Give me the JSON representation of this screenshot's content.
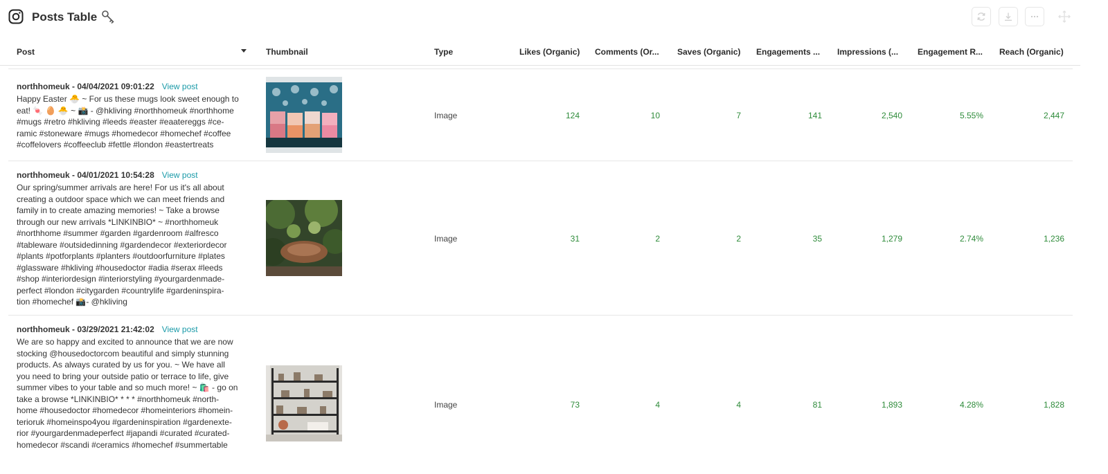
{
  "header": {
    "title": "Posts Table",
    "icons": [
      "instagram-icon",
      "key-icon",
      "refresh-icon",
      "download-icon",
      "more-icon",
      "move-icon"
    ]
  },
  "columns": [
    "Post",
    "Thumbnail",
    "Type",
    "Likes (Organic)",
    "Comments (Or...",
    "Saves (Organic)",
    "Engagements ...",
    "Impressions (...",
    "Engagement R...",
    "Reach (Organic)"
  ],
  "view_post_label": "View post",
  "rows": [
    {
      "account_date": "northhomeuk - 04/04/2021 09:01:22",
      "caption": "Happy Easter 🐣 ~ For us these mugs look sweet enough to\neat! 🍬 🥚 🐣 ~ 📸 - @hkliving #northhomeuk #northhome\n#mugs #retro #hkliving #leeds #easter #eaatereggs #ce-\nramic #stoneware #mugs #homedecor #homechef #coffee\n#coffelovers #coffeeclub #fettle #london #eastertreats",
      "type": "Image",
      "likes": "124",
      "comments": "10",
      "saves": "7",
      "engagements": "141",
      "impressions": "2,540",
      "engagement_rate": "5.55%",
      "reach": "2,447"
    },
    {
      "account_date": "northhomeuk - 04/01/2021 10:54:28",
      "caption": "Our spring/summer arrivals are here! For us it's all about\ncreating a outdoor space which we can meet friends and\nfamily in to create amazing memories! ~ Take a browse\nthrough our new arrivals *LINKINBIO* ~ #northhomeuk\n#northhome #summer #garden #gardenroom #alfresco\n#tableware #outsidedinning #gardendecor #exteriordecor\n#plants #potforplants #planters #outdoorfurniture #plates\n#glassware #hkliving #housedoctor #adia #serax #leeds\n#shop #interiordesign #interiorstyling #yourgardenmade-\nperfect #london #citygarden #countrylife #gardeninspira-\ntion #homechef 📸- @hkliving",
      "type": "Image",
      "likes": "31",
      "comments": "2",
      "saves": "2",
      "engagements": "35",
      "impressions": "1,279",
      "engagement_rate": "2.74%",
      "reach": "1,236"
    },
    {
      "account_date": "northhomeuk - 03/29/2021 21:42:02",
      "caption": "We are so happy and excited to announce that we are now\nstocking @housedoctorcom beautiful and simply stunning\nproducts. As always curated by us for you. ~ We have all\nyou need to bring your outside patio or terrace to life, give\nsummer vibes to your table and so much more! ~ 🛍️ - go on\ntake a browse *LINKINBIO* * * * #northhomeuk #north-\nhome #housedoctor #homedecor #homeinteriors #homein-\nterioruk #homeinspo4you #gardeninspiration #gardenexte-\nrior #yourgardenmadeperfect #japandi #curated #curated-\nhomedecor #scandi #ceramics #homechef #summertable",
      "type": "Image",
      "likes": "73",
      "comments": "4",
      "saves": "4",
      "engagements": "81",
      "impressions": "1,893",
      "engagement_rate": "4.28%",
      "reach": "1,828"
    }
  ]
}
